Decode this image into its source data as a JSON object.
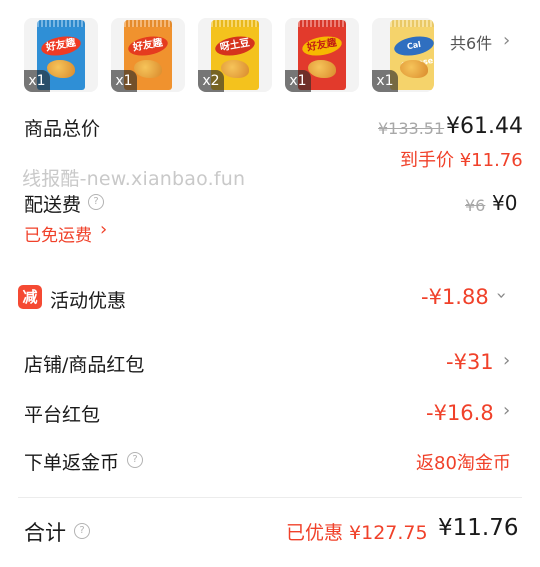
{
  "products": {
    "items": [
      {
        "qty": "x1",
        "logo": "好友趣",
        "bag_color": "#2f8fd6",
        "logo_color": "#ef3b24"
      },
      {
        "qty": "x1",
        "logo": "好友趣",
        "bag_color": "#f0922e",
        "logo_color": "#e53b1f"
      },
      {
        "qty": "x2",
        "logo": "呀土豆",
        "bag_color": "#f4c21d",
        "logo_color": "#d5331d"
      },
      {
        "qty": "x1",
        "logo": "好友趣",
        "bag_color": "#e23a2c",
        "logo_color": "#f7b800"
      },
      {
        "qty": "x1",
        "logo": "Cal Cheese",
        "bag_color": "#f5d36b",
        "logo_color": "#2f6fc0"
      }
    ],
    "more_label": "共6件"
  },
  "summary": {
    "total_label": "商品总价",
    "original_price": "¥133.51",
    "total_price": "¥61.44",
    "net_price": "到手价 ¥11.76",
    "watermark": "线报酷-new.xianbao.fun",
    "shipping_label": "配送费",
    "shipping_original": "¥6",
    "shipping_price": "¥0",
    "free_shipping": "已免运费",
    "promo_badge": "减",
    "promo_label": "活动优惠",
    "promo_value": "-¥1.88",
    "store_coupon_label": "店铺/商品红包",
    "store_coupon_value": "-¥31",
    "platform_coupon_label": "平台红包",
    "platform_coupon_value": "-¥16.8",
    "cashback_label": "下单返金币",
    "cashback_value": "返80淘金币",
    "sum_label": "合计",
    "saved_label": "已优惠 ¥127.75",
    "sum_value": "¥11.76"
  },
  "colors": {
    "accent": "#f0412a",
    "gray": "#a8a8a8"
  }
}
